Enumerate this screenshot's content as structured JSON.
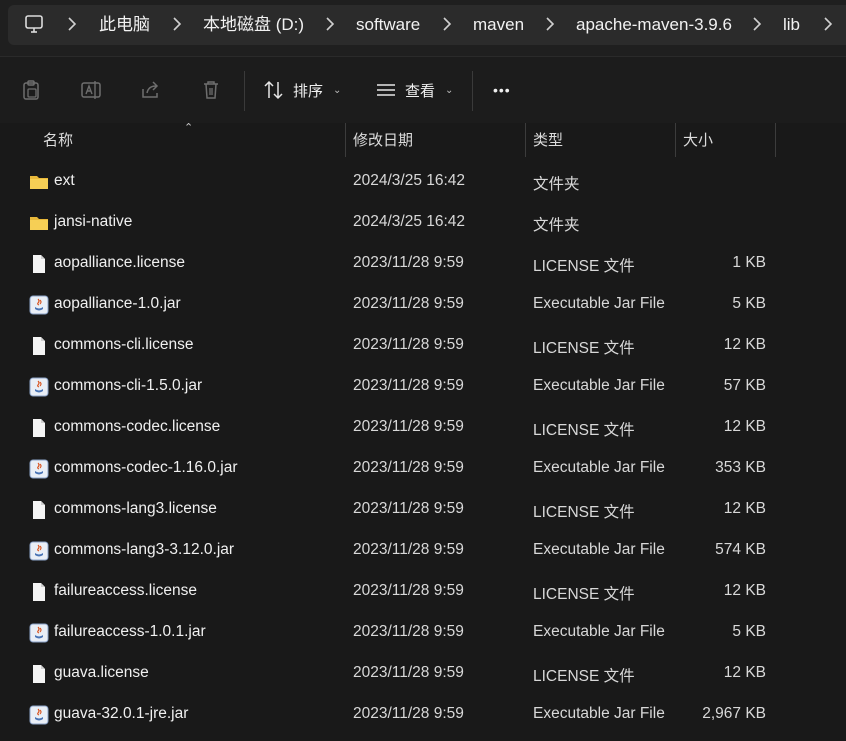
{
  "breadcrumb": {
    "items": [
      "此电脑",
      "本地磁盘 (D:)",
      "software",
      "maven",
      "apache-maven-3.9.6",
      "lib"
    ]
  },
  "toolbar": {
    "sort_label": "排序",
    "view_label": "查看",
    "more_label": "•••"
  },
  "columns": {
    "name": "名称",
    "modified": "修改日期",
    "type": "类型",
    "size": "大小"
  },
  "files": [
    {
      "name": "ext",
      "modified": "2024/3/25 16:42",
      "type": "文件夹",
      "size": "",
      "icon": "folder-icon"
    },
    {
      "name": "jansi-native",
      "modified": "2024/3/25 16:42",
      "type": "文件夹",
      "size": "",
      "icon": "folder-icon"
    },
    {
      "name": "aopalliance.license",
      "modified": "2023/11/28 9:59",
      "type": "LICENSE 文件",
      "size": "1 KB",
      "icon": "file-icon"
    },
    {
      "name": "aopalliance-1.0.jar",
      "modified": "2023/11/28 9:59",
      "type": "Executable Jar File",
      "size": "5 KB",
      "icon": "jar-icon"
    },
    {
      "name": "commons-cli.license",
      "modified": "2023/11/28 9:59",
      "type": "LICENSE 文件",
      "size": "12 KB",
      "icon": "file-icon"
    },
    {
      "name": "commons-cli-1.5.0.jar",
      "modified": "2023/11/28 9:59",
      "type": "Executable Jar File",
      "size": "57 KB",
      "icon": "jar-icon"
    },
    {
      "name": "commons-codec.license",
      "modified": "2023/11/28 9:59",
      "type": "LICENSE 文件",
      "size": "12 KB",
      "icon": "file-icon"
    },
    {
      "name": "commons-codec-1.16.0.jar",
      "modified": "2023/11/28 9:59",
      "type": "Executable Jar File",
      "size": "353 KB",
      "icon": "jar-icon"
    },
    {
      "name": "commons-lang3.license",
      "modified": "2023/11/28 9:59",
      "type": "LICENSE 文件",
      "size": "12 KB",
      "icon": "file-icon"
    },
    {
      "name": "commons-lang3-3.12.0.jar",
      "modified": "2023/11/28 9:59",
      "type": "Executable Jar File",
      "size": "574 KB",
      "icon": "jar-icon"
    },
    {
      "name": "failureaccess.license",
      "modified": "2023/11/28 9:59",
      "type": "LICENSE 文件",
      "size": "12 KB",
      "icon": "file-icon"
    },
    {
      "name": "failureaccess-1.0.1.jar",
      "modified": "2023/11/28 9:59",
      "type": "Executable Jar File",
      "size": "5 KB",
      "icon": "jar-icon"
    },
    {
      "name": "guava.license",
      "modified": "2023/11/28 9:59",
      "type": "LICENSE 文件",
      "size": "12 KB",
      "icon": "file-icon"
    },
    {
      "name": "guava-32.0.1-jre.jar",
      "modified": "2023/11/28 9:59",
      "type": "Executable Jar File",
      "size": "2,967 KB",
      "icon": "jar-icon"
    }
  ]
}
